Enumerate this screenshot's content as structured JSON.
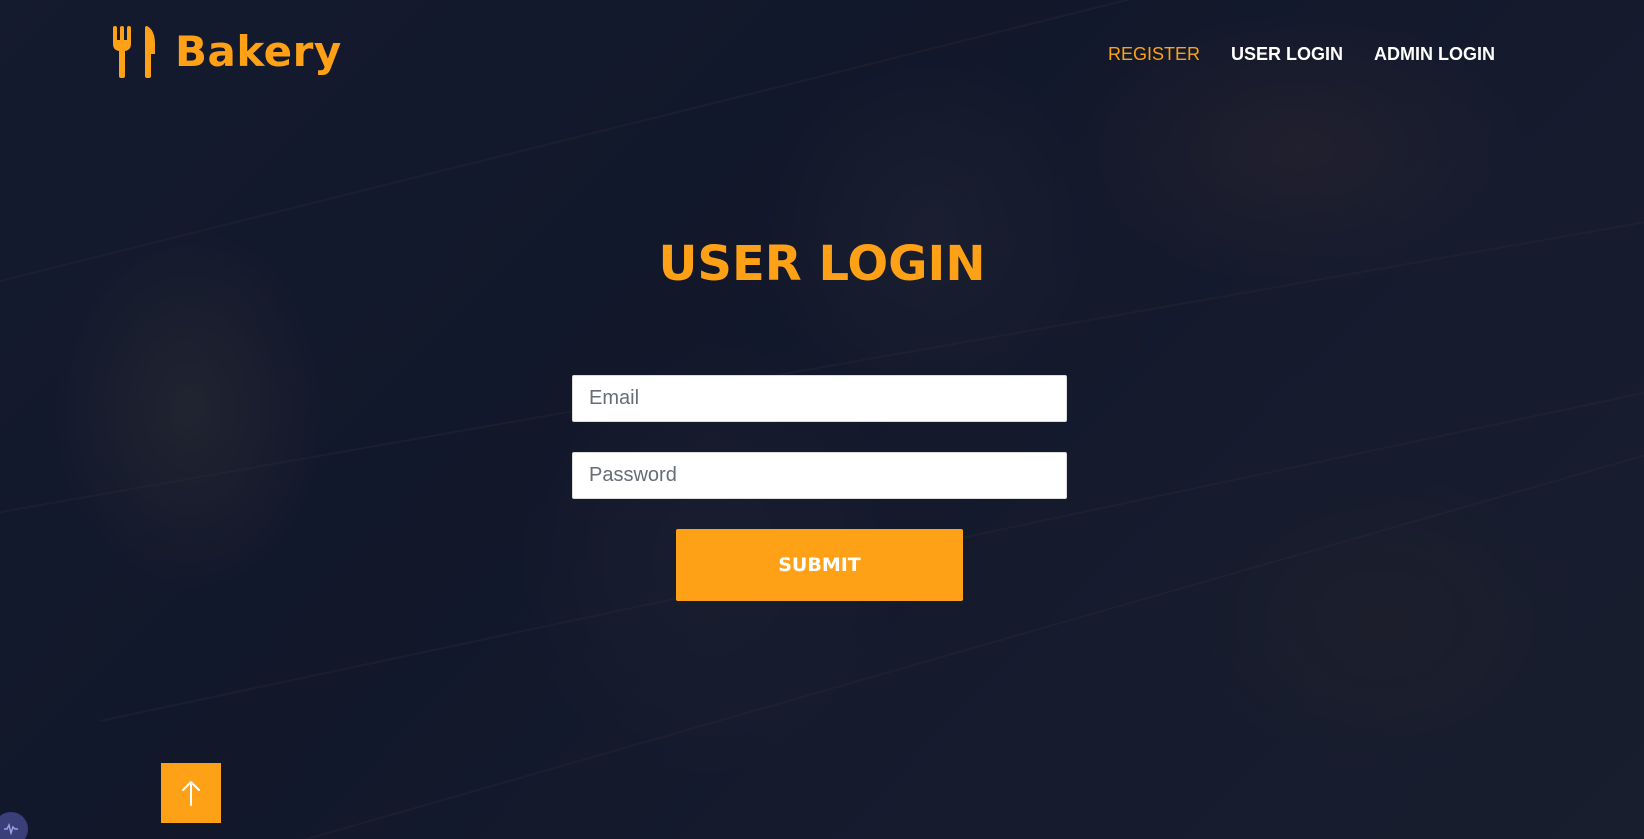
{
  "brand": {
    "name": "Bakery",
    "icon": "utensils-icon",
    "color": "#fea116"
  },
  "nav": {
    "items": [
      {
        "label": "REGISTER",
        "active": true
      },
      {
        "label": "USER LOGIN",
        "active": false
      },
      {
        "label": "ADMIN LOGIN",
        "active": false
      }
    ]
  },
  "page": {
    "title": "USER LOGIN"
  },
  "form": {
    "email": {
      "placeholder": "Email",
      "value": ""
    },
    "password": {
      "placeholder": "Password",
      "value": ""
    },
    "submit_label": "SUBMIT"
  },
  "back_to_top": {
    "icon": "arrow-up-icon"
  },
  "corner_widget": {
    "icon": "waveform-icon"
  },
  "colors": {
    "accent": "#fea116",
    "nav_text": "#ffffff",
    "overlay": "#0e1428"
  }
}
